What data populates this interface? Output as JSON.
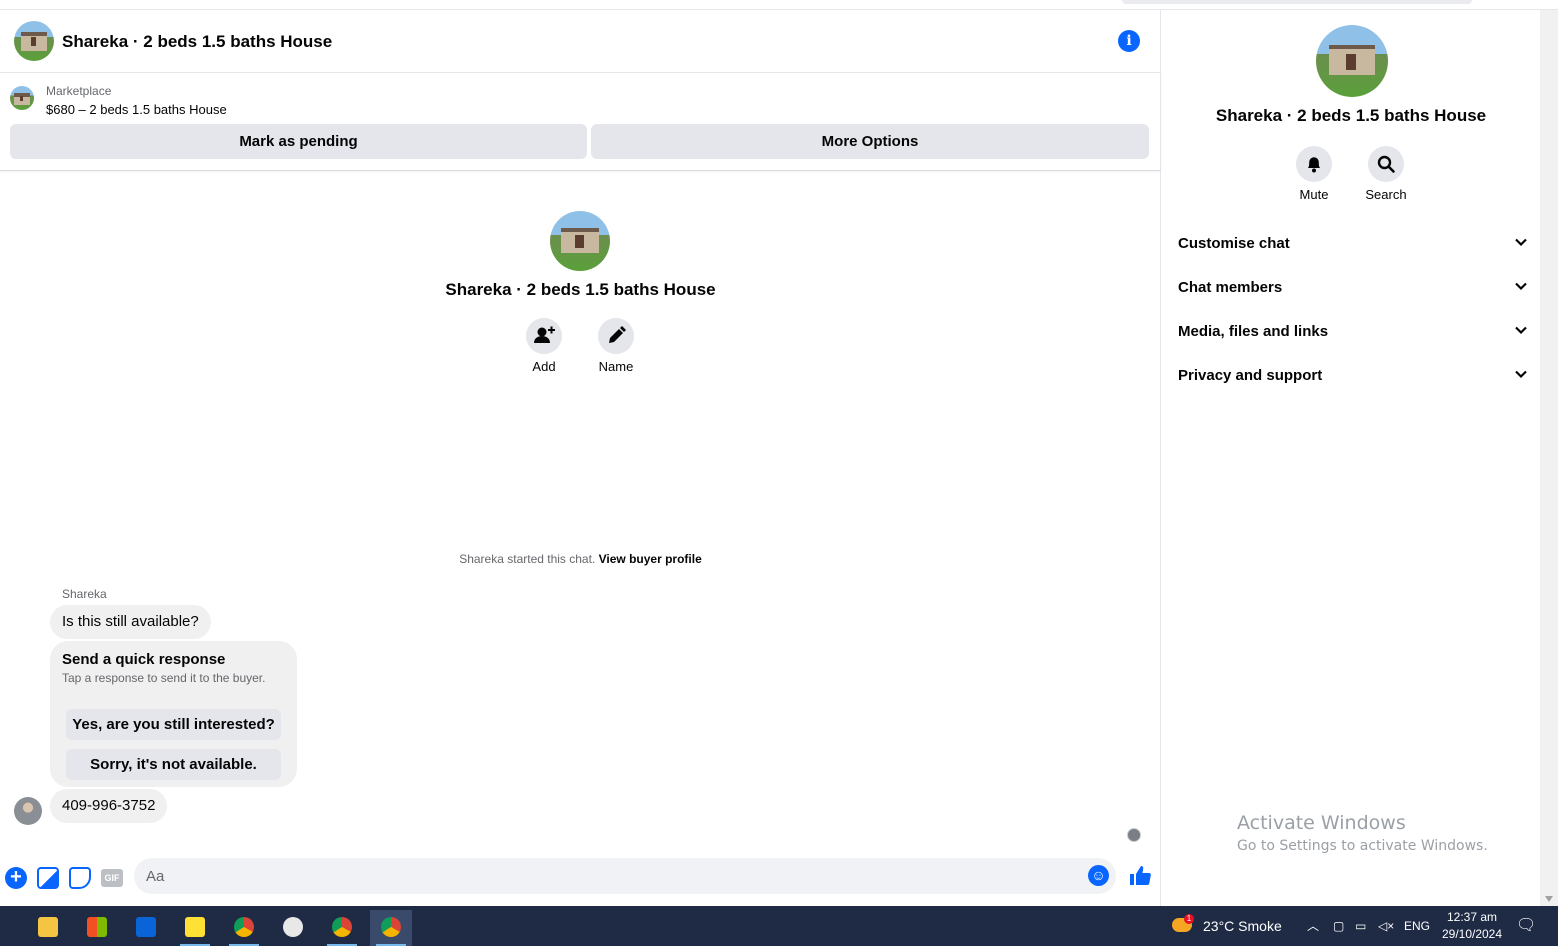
{
  "header": {
    "title": "Shareka · 2 beds 1.5 baths House",
    "info_icon": "info-icon"
  },
  "listing": {
    "source": "Marketplace",
    "title": "$680 – 2 beds 1.5 baths House",
    "mark_pending_label": "Mark as pending",
    "more_options_label": "More Options"
  },
  "conversation": {
    "title": "Shareka · 2 beds 1.5 baths House",
    "actions": [
      {
        "label": "Add",
        "icon": "add-person-icon"
      },
      {
        "label": "Name",
        "icon": "pencil-icon"
      }
    ],
    "started_text": "Shareka started this chat.",
    "buyer_profile_link": "View buyer profile",
    "sender_name": "Shareka",
    "messages": [
      {
        "text": "Is this still available?"
      },
      {
        "text": "409-996-3752"
      }
    ],
    "quick_response": {
      "title": "Send a quick response",
      "subtitle": "Tap a response to send it to the buyer.",
      "options": [
        "Yes, are you still interested?",
        "Sorry, it's not available."
      ]
    }
  },
  "composer": {
    "placeholder": "Aa",
    "gif_label": "GIF"
  },
  "sidebar": {
    "title": "Shareka · 2 beds 1.5 baths House",
    "actions": [
      {
        "label": "Mute",
        "icon": "bell-icon"
      },
      {
        "label": "Search",
        "icon": "search-icon"
      }
    ],
    "sections": [
      {
        "label": "Customise chat"
      },
      {
        "label": "Chat members"
      },
      {
        "label": "Media, files and links"
      },
      {
        "label": "Privacy and support"
      }
    ],
    "watermark": {
      "line1": "Activate Windows",
      "line2": "Go to Settings to activate Windows."
    }
  },
  "taskbar": {
    "weather": "23°C  Smoke",
    "weather_badge": "1",
    "language": "ENG",
    "time": "12:37 am",
    "date": "29/10/2024"
  },
  "colors": {
    "accent": "#0866ff",
    "bubble": "#f0f0f0",
    "button": "#e4e6eb",
    "taskbar": "#1f2a44"
  }
}
